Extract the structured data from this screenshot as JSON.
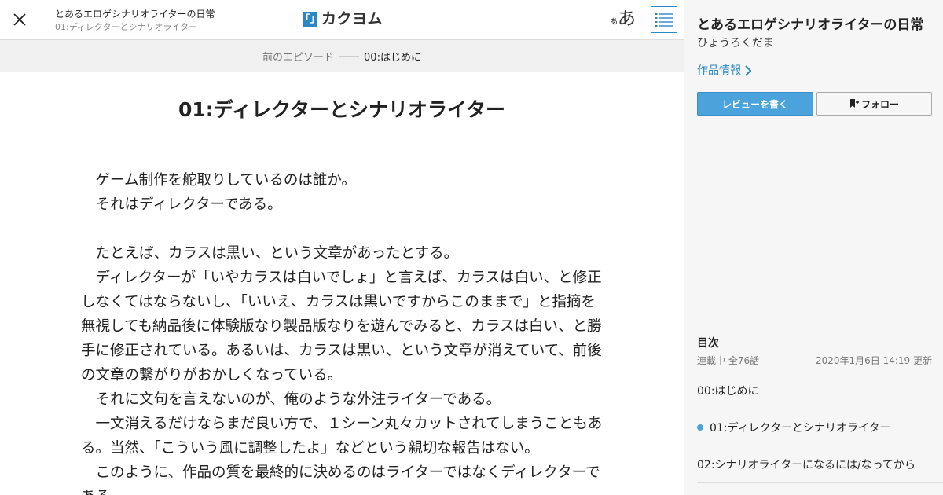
{
  "header": {
    "work_title": "とあるエロゲシナリオライターの日常",
    "episode_subtitle": "01:ディレクターとシナリオライター",
    "logo_mark": "「」",
    "logo_text": "カクヨム",
    "font_small": "あ",
    "font_big": "あ",
    "icons": {
      "close": "close-icon",
      "toc": "list-icon"
    }
  },
  "episode_nav": {
    "prev_label": "前のエピソード",
    "current_label": "00:はじめに"
  },
  "episode": {
    "title": "01:ディレクターとシナリオライター",
    "paragraphs": [
      "　ゲーム制作を舵取りしているのは誰か。",
      "　それはディレクターである。",
      "",
      "　たとえば、カラスは黒い、という文章があったとする。",
      "　ディレクターが「いやカラスは白いでしょ」と言えば、カラスは白い、と修正",
      "しなくてはならないし、「いいえ、カラスは黒いですからこのままで」と指摘を",
      "無視しても納品後に体験版なり製品版なりを遊んでみると、カラスは白い、と勝",
      "手に修正されている。あるいは、カラスは黒い、という文章が消えていて、前後",
      "の文章の繋がりがおかしくなっている。",
      "　それに文句を言えないのが、俺のような外注ライターである。",
      "　一文消えるだけならまだ良い方で、１シーン丸々カットされてしまうこともあ",
      "る。当然、「こういう風に調整したよ」などという親切な報告はない。",
      "　このように、作品の質を最終的に決めるのはライターではなくディレクターで",
      "ある。"
    ]
  },
  "sidebar": {
    "work_title": "とあるエロゲシナリオライターの日常",
    "author": "ひょうろくだま",
    "info_link": "作品情報",
    "review_button": "レビューを書く",
    "follow_button": "フォロー",
    "toc_heading": "目次",
    "toc_status": "連載中 全76話",
    "toc_updated": "2020年1月6日 14:19 更新",
    "toc_items": [
      {
        "label": "00:はじめに",
        "current": false
      },
      {
        "label": "01:ディレクターとシナリオライター",
        "current": true
      },
      {
        "label": "02:シナリオライターになるには/なってから",
        "current": false
      }
    ],
    "accent_color": "#2b88c6",
    "button_color": "#4ba3dc"
  }
}
